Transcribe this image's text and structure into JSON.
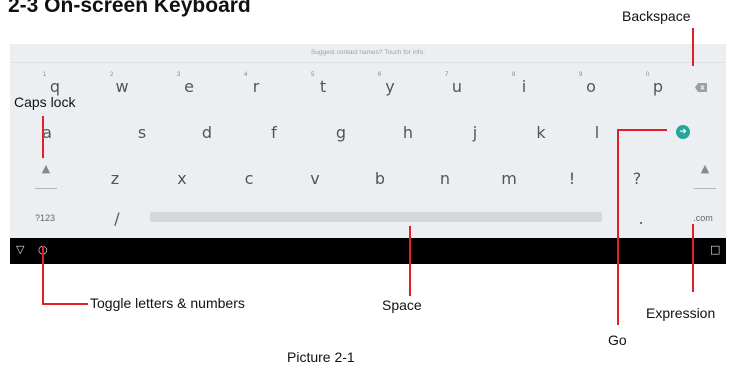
{
  "title": "2-3 On-screen Keyboard",
  "keyboard": {
    "hint": "Suggest contact names? Touch for info.",
    "row1": [
      {
        "label": "q",
        "num": "1"
      },
      {
        "label": "w",
        "num": "2"
      },
      {
        "label": "e",
        "num": "3"
      },
      {
        "label": "r",
        "num": "4"
      },
      {
        "label": "t",
        "num": "5"
      },
      {
        "label": "y",
        "num": "6"
      },
      {
        "label": "u",
        "num": "7"
      },
      {
        "label": "i",
        "num": "8"
      },
      {
        "label": "o",
        "num": "9"
      },
      {
        "label": "p",
        "num": "0"
      }
    ],
    "row2": [
      "a",
      "s",
      "d",
      "f",
      "g",
      "h",
      "j",
      "k",
      "l"
    ],
    "row3": [
      "z",
      "x",
      "c",
      "v",
      "b",
      "n",
      "m",
      "!",
      "?"
    ],
    "symbols_key": "?123",
    "slash_key": "/",
    "period_key": ".",
    "com_key": ".com",
    "backspace_icon": "backspace-icon",
    "shift_icon": "shift-icon",
    "go_icon": "go-arrow-icon",
    "go_color": "#26a69a"
  },
  "navbar": {
    "back_icon": "back-triangle-icon",
    "home_icon": "home-circle-icon",
    "recent_icon": "recent-square-icon"
  },
  "callouts": {
    "backspace": "Backspace",
    "caps_lock": "Caps lock",
    "toggle": "Toggle letters & numbers",
    "space": "Space",
    "expression": "Expression",
    "go": "Go"
  },
  "pointer_color": "#e41e26",
  "caption": "Picture 2-1"
}
